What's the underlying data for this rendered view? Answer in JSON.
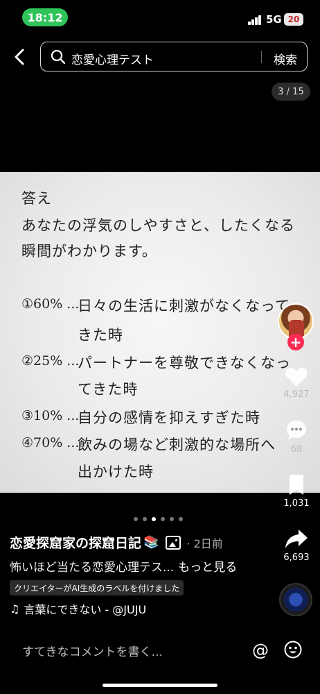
{
  "status_bar": {
    "time": "18:12",
    "network": "5G",
    "battery": "20",
    "time_pill_color": "#30c35a"
  },
  "search": {
    "query": "恋愛心理テスト",
    "button_label": "検索"
  },
  "page_counter": "3 / 15",
  "post_image": {
    "heading": "答え",
    "intro_line1": "あなたの浮気のしやすさと、したくなる",
    "intro_line2": "瞬間がわかります。",
    "items": [
      {
        "num": "①60% ...",
        "line1": "日々の生活に刺激がなくなって",
        "line2": "きた時"
      },
      {
        "num": "②25% ...",
        "line1": "パートナーを尊敬できなくなっ",
        "line2": "てきた時"
      },
      {
        "num": "③10% ...",
        "line1": "自分の感情を抑えすぎた時",
        "line2": ""
      },
      {
        "num": "④70% ...",
        "line1": "飲みの場など刺激的な場所へ",
        "line2": "出かけた時"
      }
    ]
  },
  "right_rail": {
    "follow_label": "+",
    "likes": "4,927",
    "comments": "68",
    "bookmarks": "1,031",
    "shares": "6,693",
    "accent_color": "#fe2c55"
  },
  "pagination": {
    "total": 6,
    "active_index": 2
  },
  "author": {
    "name": "恋愛探窟家の探窟日記",
    "emoji": "📚",
    "time": "· 2日前"
  },
  "caption": {
    "text": "怖いほど当たる恋愛心理テス...",
    "more": "もっと見る"
  },
  "ai_label": "クリエイターがAI生成のラベルを付けました",
  "music": {
    "icon": "♫",
    "text": "言葉にできない - @JUJU"
  },
  "comment_bar": {
    "placeholder": "すてきなコメントを書く...",
    "mention": "@"
  }
}
